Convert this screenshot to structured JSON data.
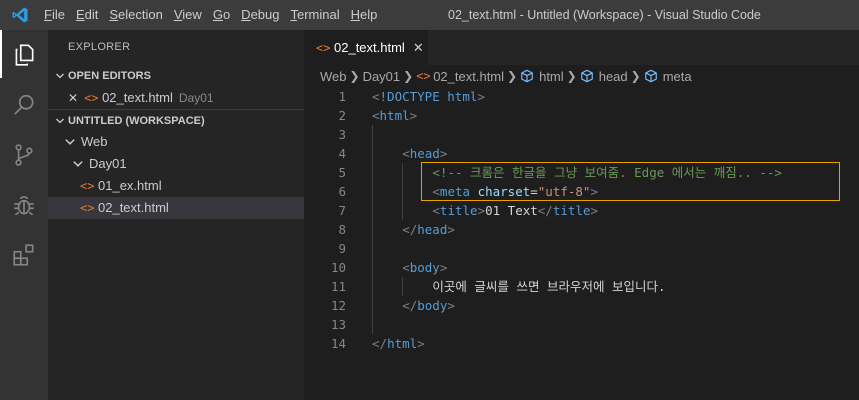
{
  "window": {
    "title": "02_text.html - Untitled (Workspace) - Visual Studio Code"
  },
  "menu": [
    {
      "label": "File",
      "mnemonic": "F",
      "rest": "ile"
    },
    {
      "label": "Edit",
      "mnemonic": "E",
      "rest": "dit"
    },
    {
      "label": "Selection",
      "mnemonic": "S",
      "rest": "election"
    },
    {
      "label": "View",
      "mnemonic": "V",
      "rest": "iew"
    },
    {
      "label": "Go",
      "mnemonic": "G",
      "rest": "o"
    },
    {
      "label": "Debug",
      "mnemonic": "D",
      "rest": "ebug"
    },
    {
      "label": "Terminal",
      "mnemonic": "T",
      "rest": "erminal"
    },
    {
      "label": "Help",
      "mnemonic": "H",
      "rest": "elp"
    }
  ],
  "activity": [
    "explorer-icon",
    "search-icon",
    "source-control-icon",
    "debug-icon",
    "extensions-icon"
  ],
  "sidebar": {
    "title": "EXPLORER",
    "open_editors": {
      "label": "OPEN EDITORS",
      "items": [
        {
          "close": "✕",
          "icon": "<>",
          "name": "02_text.html",
          "folder": "Day01"
        }
      ]
    },
    "workspace": {
      "label": "UNTITLED (WORKSPACE)",
      "folder_web": "Web",
      "folder_day01": "Day01",
      "files": [
        {
          "name": "01_ex.html",
          "icon": "<>",
          "selected": false
        },
        {
          "name": "02_text.html",
          "icon": "<>",
          "selected": true
        }
      ]
    }
  },
  "tabs": [
    {
      "icon": "<>",
      "label": "02_text.html",
      "close": "✕"
    }
  ],
  "breadcrumb": {
    "items": [
      "Web",
      "Day01",
      "02_text.html",
      "html",
      "head",
      "meta"
    ],
    "file_icon": "<>"
  },
  "editor": {
    "lines": [
      {
        "n": "1",
        "indent": 0,
        "tokens": [
          [
            "br",
            "<"
          ],
          [
            "tag",
            "!DOCTYPE"
          ],
          [
            "txt",
            " "
          ],
          [
            "tag",
            "html"
          ],
          [
            "br",
            ">"
          ]
        ]
      },
      {
        "n": "2",
        "indent": 0,
        "tokens": [
          [
            "br",
            "<"
          ],
          [
            "tag",
            "html"
          ],
          [
            "br",
            ">"
          ]
        ]
      },
      {
        "n": "3",
        "indent": 0,
        "tokens": []
      },
      {
        "n": "4",
        "indent": 1,
        "tokens": [
          [
            "br",
            "<"
          ],
          [
            "tag",
            "head"
          ],
          [
            "br",
            ">"
          ]
        ]
      },
      {
        "n": "5",
        "indent": 2,
        "tokens": [
          [
            "com",
            "<!-- 크롬은 한글을 그냥 보여줌. Edge 에서는 깨짐.. -->"
          ]
        ]
      },
      {
        "n": "6",
        "indent": 2,
        "tokens": [
          [
            "br",
            "<"
          ],
          [
            "tag",
            "meta"
          ],
          [
            "txt",
            " "
          ],
          [
            "attr",
            "charset"
          ],
          [
            "txt",
            "="
          ],
          [
            "str",
            "\"utf-8\""
          ],
          [
            "br",
            ">"
          ]
        ]
      },
      {
        "n": "7",
        "indent": 2,
        "tokens": [
          [
            "br",
            "<"
          ],
          [
            "tag",
            "title"
          ],
          [
            "br",
            ">"
          ],
          [
            "txt",
            "01 Text"
          ],
          [
            "br",
            "</"
          ],
          [
            "tag",
            "title"
          ],
          [
            "br",
            ">"
          ]
        ]
      },
      {
        "n": "8",
        "indent": 1,
        "tokens": [
          [
            "br",
            "</"
          ],
          [
            "tag",
            "head"
          ],
          [
            "br",
            ">"
          ]
        ]
      },
      {
        "n": "9",
        "indent": 0,
        "tokens": []
      },
      {
        "n": "10",
        "indent": 1,
        "tokens": [
          [
            "br",
            "<"
          ],
          [
            "tag",
            "body"
          ],
          [
            "br",
            ">"
          ]
        ]
      },
      {
        "n": "11",
        "indent": 2,
        "tokens": [
          [
            "txt",
            "이곳에 글씨를 쓰면 브라우저에 보입니다."
          ]
        ]
      },
      {
        "n": "12",
        "indent": 1,
        "tokens": [
          [
            "br",
            "</"
          ],
          [
            "tag",
            "body"
          ],
          [
            "br",
            ">"
          ]
        ]
      },
      {
        "n": "13",
        "indent": 0,
        "tokens": []
      },
      {
        "n": "14",
        "indent": 0,
        "tokens": [
          [
            "br",
            "</"
          ],
          [
            "tag",
            "html"
          ],
          [
            "br",
            ">"
          ]
        ]
      }
    ]
  },
  "colors": {
    "accent_highlight": "#e5a100",
    "tag": "#569cd6",
    "attribute": "#9cdcfe",
    "string": "#ce9178",
    "comment": "#6a9955",
    "html_file_icon": "#e37933"
  }
}
